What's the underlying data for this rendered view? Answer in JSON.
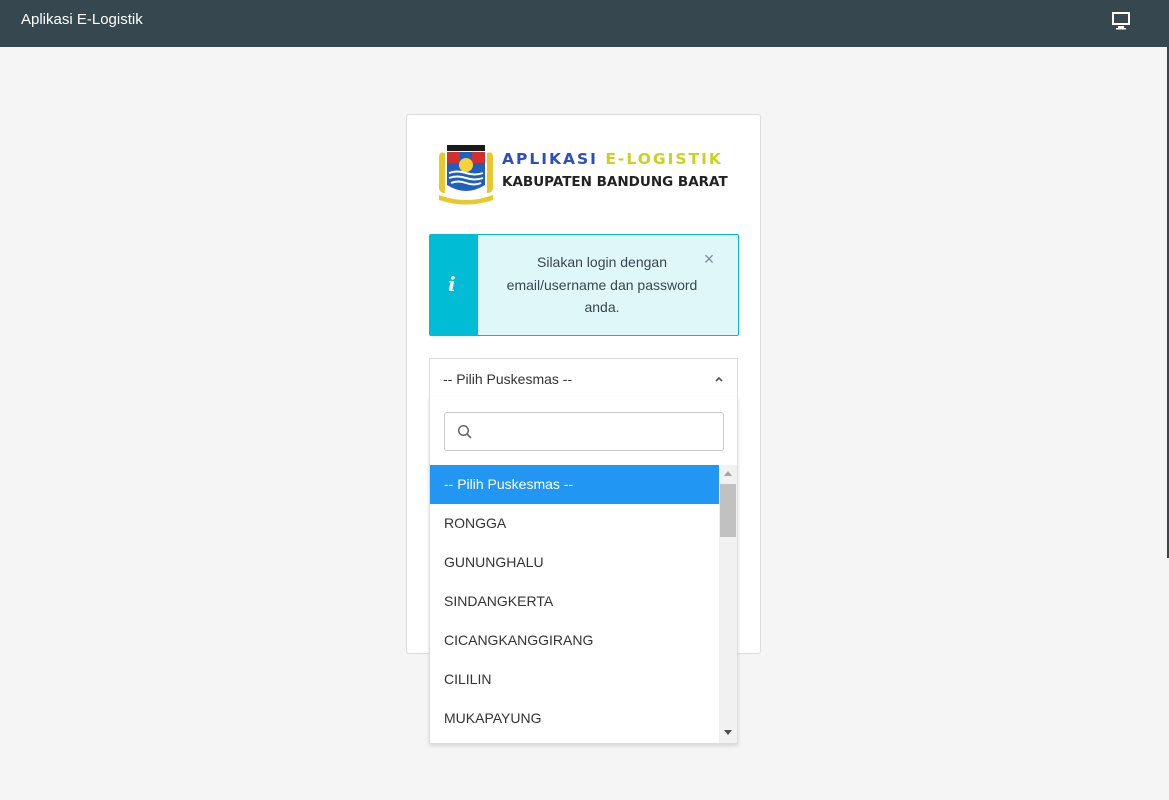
{
  "navbar": {
    "title": "Aplikasi E-Logistik",
    "icon": "monitor-icon"
  },
  "logo": {
    "line1_part1": "APLIKASI ",
    "line1_part2": "E-LOGISTIK",
    "line2": "KABUPATEN BANDUNG BARAT",
    "seal_icon": "kabupaten-seal-icon"
  },
  "alert": {
    "icon": "info-icon",
    "message": "Silakan login dengan email/username dan password anda.",
    "close_icon": "close-icon"
  },
  "select": {
    "value": "-- Pilih Puskesmas --",
    "caret_icon": "chevron-up-icon"
  },
  "dropdown": {
    "search_icon": "search-icon",
    "search_value": "",
    "options": [
      "-- Pilih Puskesmas --",
      "RONGGA",
      "GUNUNGHALU",
      "SINDANGKERTA",
      "CICANGKANGGIRANG",
      "CILILIN",
      "MUKAPAYUNG"
    ],
    "selected_index": 0
  },
  "colors": {
    "navbar": "#37474f",
    "alert_accent": "#00bcd4",
    "alert_bg": "#e0f7fa",
    "selected_option": "#2196f3",
    "logo_blue": "#2b4fbf",
    "logo_yellow": "#c9d21f"
  }
}
